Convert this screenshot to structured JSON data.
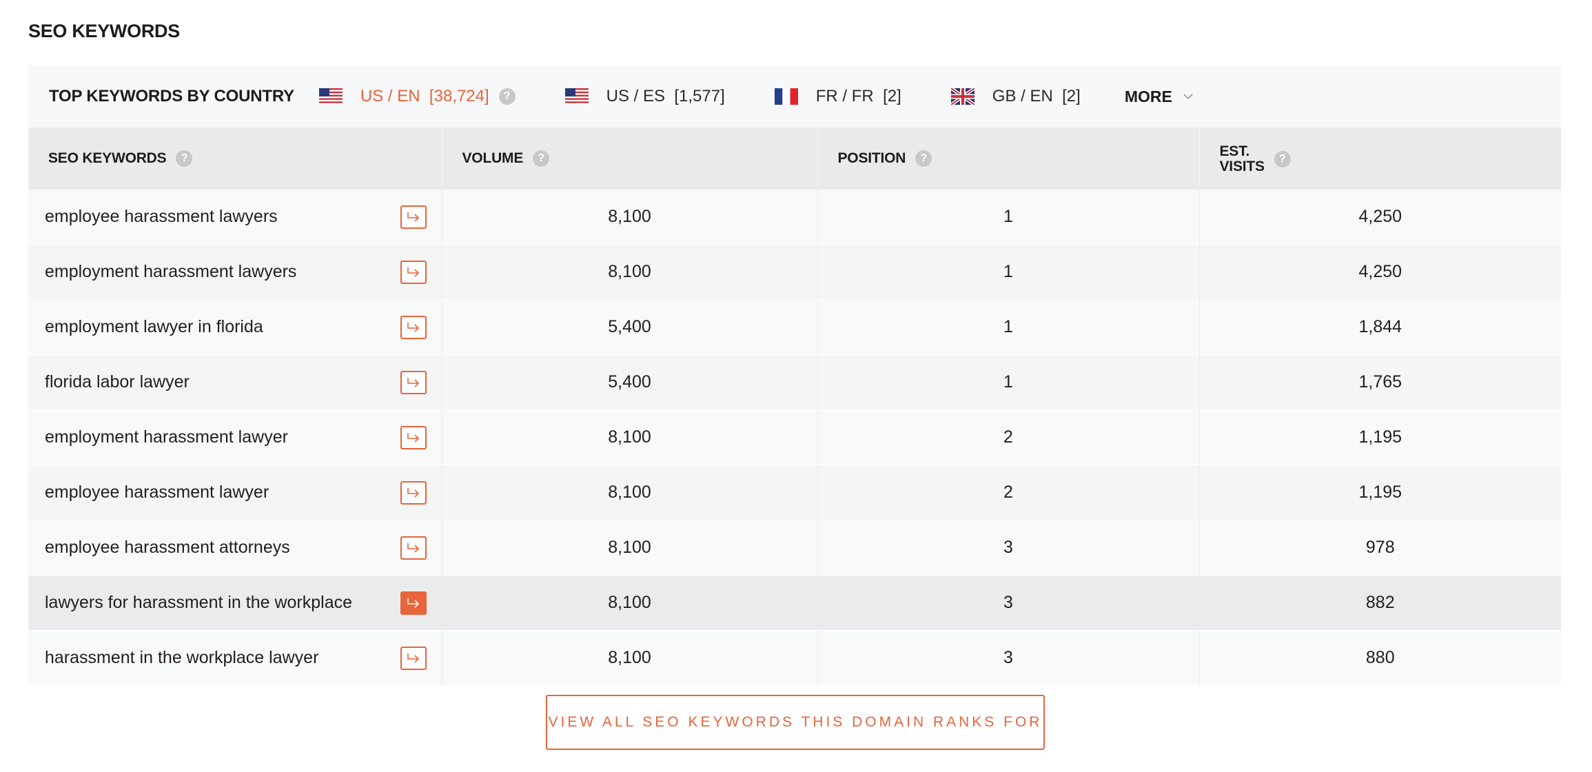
{
  "section_title": "SEO KEYWORDS",
  "country_bar": {
    "title": "TOP KEYWORDS BY COUNTRY",
    "countries": [
      {
        "label": "US / EN  [38,724]",
        "flag": "us-flag-icon",
        "active": true
      },
      {
        "label": "US / ES  [1,577]",
        "flag": "us-flag-icon",
        "active": false
      },
      {
        "label": "FR / FR  [2]",
        "flag": "fr-flag-icon",
        "active": false
      },
      {
        "label": "GB / EN  [2]",
        "flag": "gb-flag-icon",
        "active": false
      }
    ],
    "more_label": "MORE"
  },
  "table": {
    "headers": {
      "keywords": "SEO KEYWORDS",
      "volume": "VOLUME",
      "position": "POSITION",
      "visits_line1": "EST.",
      "visits_line2": "VISITS"
    },
    "rows": [
      {
        "keyword": "employee harassment lawyers",
        "volume": "8,100",
        "position": "1",
        "visits": "4,250"
      },
      {
        "keyword": "employment harassment lawyers",
        "volume": "8,100",
        "position": "1",
        "visits": "4,250"
      },
      {
        "keyword": "employment lawyer in florida",
        "volume": "5,400",
        "position": "1",
        "visits": "1,844"
      },
      {
        "keyword": "florida labor lawyer",
        "volume": "5,400",
        "position": "1",
        "visits": "1,765"
      },
      {
        "keyword": "employment harassment lawyer",
        "volume": "8,100",
        "position": "2",
        "visits": "1,195"
      },
      {
        "keyword": "employee harassment lawyer",
        "volume": "8,100",
        "position": "2",
        "visits": "1,195"
      },
      {
        "keyword": "employee harassment attorneys",
        "volume": "8,100",
        "position": "3",
        "visits": "978"
      },
      {
        "keyword": "lawyers for harassment in the workplace",
        "volume": "8,100",
        "position": "3",
        "visits": "882"
      },
      {
        "keyword": "harassment in the workplace lawyer",
        "volume": "8,100",
        "position": "3",
        "visits": "880"
      }
    ]
  },
  "view_all_label": "VIEW ALL SEO KEYWORDS THIS DOMAIN RANKS FOR",
  "colors": {
    "accent": "#e8643a",
    "header_bg": "#eaeaec",
    "bar_bg": "#f7f8fa"
  }
}
